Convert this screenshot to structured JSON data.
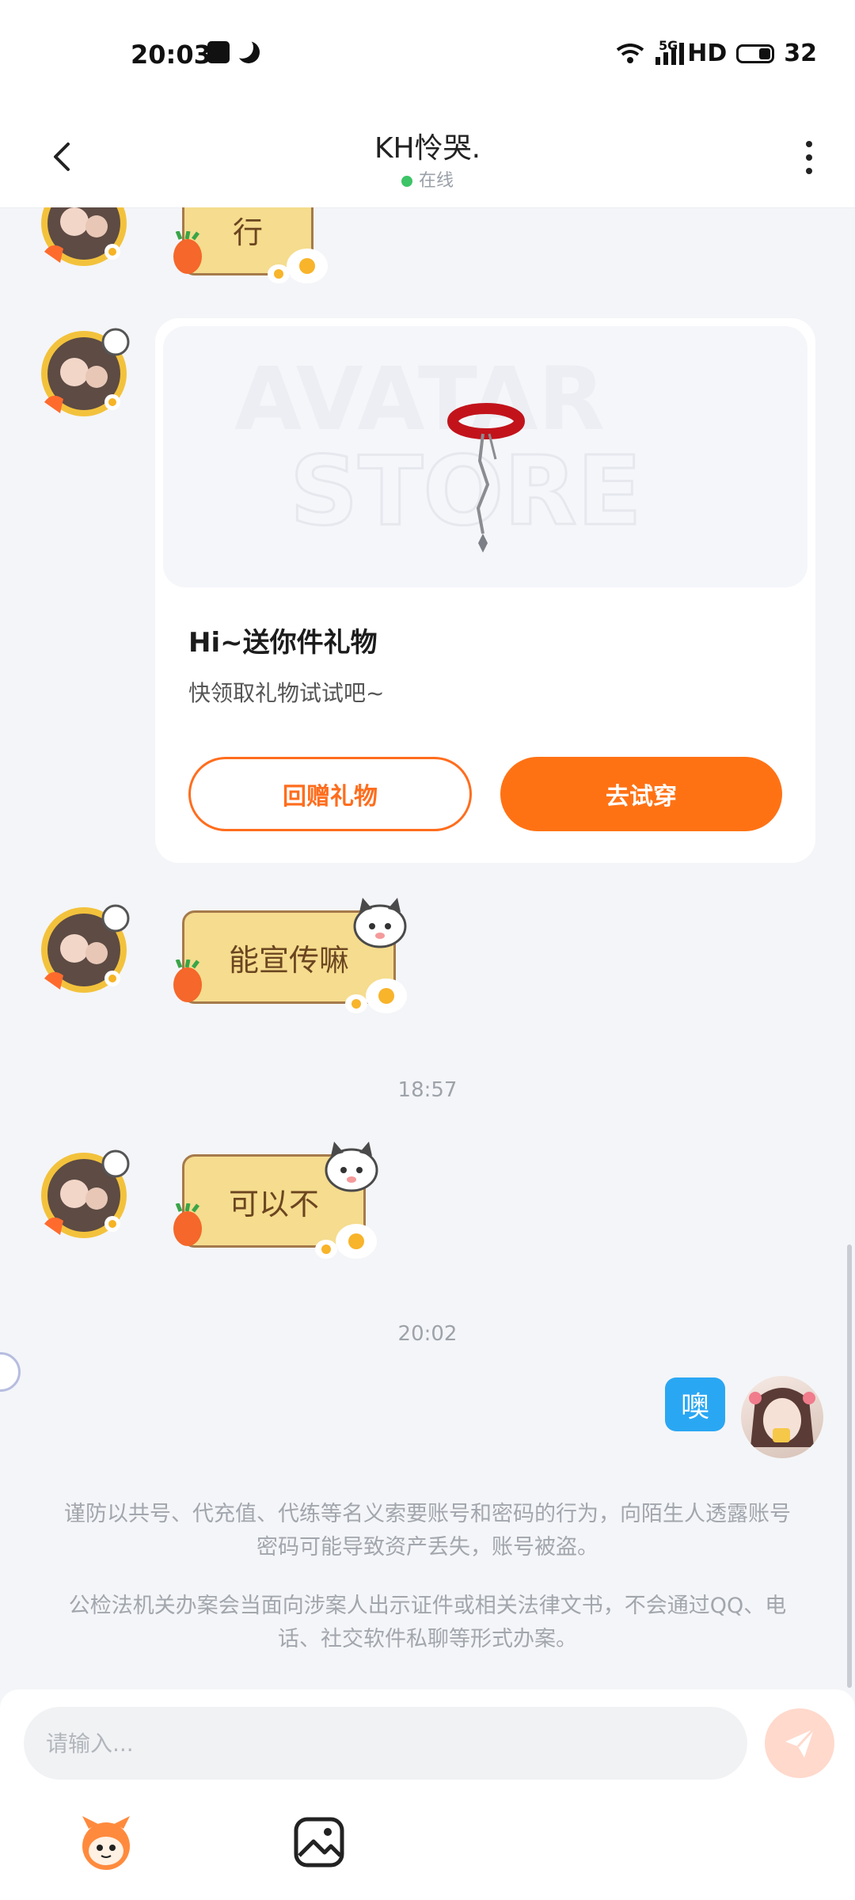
{
  "status_bar": {
    "time": "20:03",
    "network": "5G",
    "hd": "HD",
    "battery": "32"
  },
  "header": {
    "title": "KH怜哭.",
    "status": "在线"
  },
  "messages": {
    "sticker_1": "行",
    "gift": {
      "title": "Hi~送你件礼物",
      "subtitle": "快领取礼物试试吧~",
      "preview_watermark_1": "AVATAR",
      "preview_watermark_2": "STORE",
      "return_gift_label": "回赠礼物",
      "try_on_label": "去试穿"
    },
    "sticker_2": "能宣传嘛",
    "time_1": "18:57",
    "sticker_3": "可以不",
    "time_2": "20:02",
    "my_message": "噢"
  },
  "notices": {
    "notice_1": "谨防以共号、代充值、代练等名义索要账号和密码的行为，向陌生人透露账号密码可能导致资产丢失，账号被盗。",
    "notice_2": "公检法机关办案会当面向涉案人出示证件或相关法律文书，不会通过QQ、电话、社交软件私聊等形式办案。"
  },
  "composer": {
    "placeholder": "请输入..."
  },
  "colors": {
    "accent_orange": "#ff7214",
    "my_bubble_blue": "#2aa7f3",
    "sticker_fill": "#f5dc8e",
    "online_green": "#3cc466"
  },
  "icons": [
    "back-arrow-icon",
    "more-vertical-icon",
    "wifi-icon",
    "signal-icon",
    "battery-icon",
    "send-icon",
    "emoji-icon",
    "image-icon"
  ]
}
